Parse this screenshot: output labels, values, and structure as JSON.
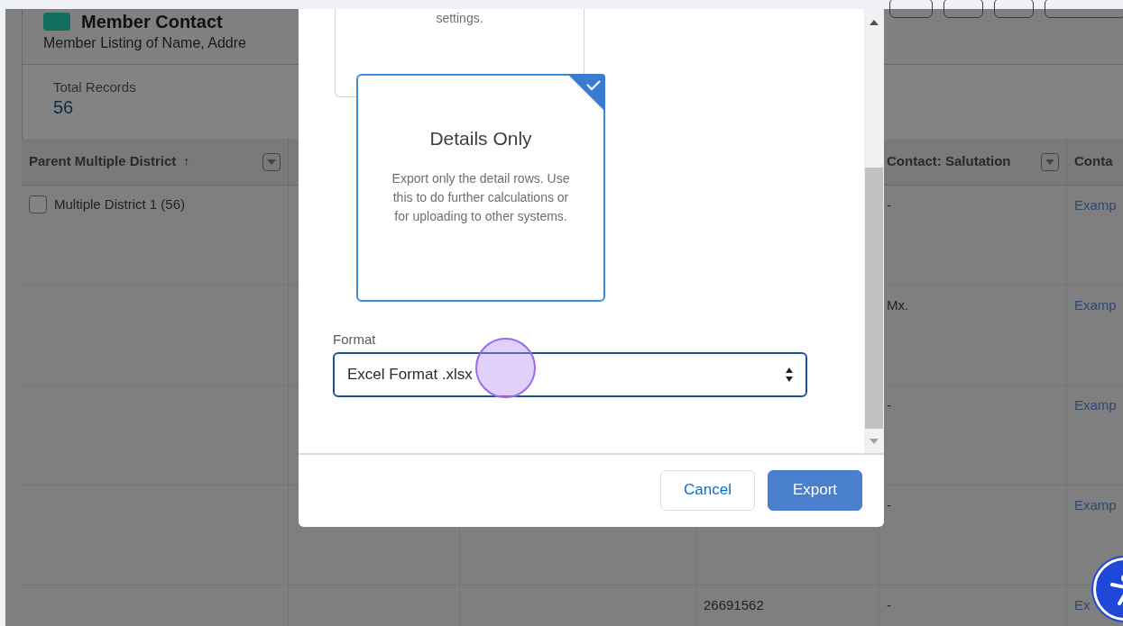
{
  "header": {
    "title": "Member Contact",
    "subtitle": "Member Listing of Name, Addre"
  },
  "summary": {
    "label": "Total Records",
    "value": "56"
  },
  "table": {
    "columns": [
      {
        "label": "Parent Multiple District",
        "sort_indicator": "↑"
      },
      {
        "label": "Contact: Salutation"
      },
      {
        "label": "Conta"
      }
    ],
    "rows": [
      {
        "district": "Multiple District 1 (56)",
        "checked": false,
        "salutation": "-",
        "column_6": "Examp"
      },
      {
        "salutation": "Mx.",
        "column_6": "Examp"
      },
      {
        "salutation": "-",
        "column_6": "Examp"
      },
      {
        "salutation": "-",
        "column_6": "Examp"
      },
      {
        "column_4": "26691562",
        "salutation": "-",
        "column_6": "Ex"
      }
    ]
  },
  "modal": {
    "cards": [
      {
        "text": "settings.",
        "selected": false
      },
      {
        "title": "Details Only",
        "text": "Export only the detail rows. Use this to do further calculations or for uploading to other systems.",
        "selected": true
      }
    ],
    "format": {
      "label": "Format",
      "value": "Excel Format .xlsx"
    },
    "buttons": [
      {
        "label": "Cancel",
        "kind": "neutral"
      },
      {
        "label": "Export",
        "kind": "brand"
      }
    ]
  }
}
